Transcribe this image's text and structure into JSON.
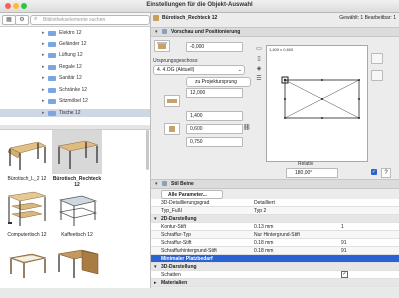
{
  "window": {
    "title": "Einstellungen für die Objekt-Auswahl"
  },
  "library": {
    "search_placeholder": "Bibliothekselemente suchen",
    "tree": [
      {
        "label": "Elektro 12",
        "selected": false
      },
      {
        "label": "Geländer 12",
        "selected": false
      },
      {
        "label": "Lüftung 12",
        "selected": false
      },
      {
        "label": "Regale 12",
        "selected": false
      },
      {
        "label": "Sanitär 12",
        "selected": false
      },
      {
        "label": "Schränke 12",
        "selected": false
      },
      {
        "label": "Sitzmöbel 12",
        "selected": false
      },
      {
        "label": "Tische 12",
        "selected": true
      }
    ],
    "objects": [
      {
        "label": "Bürotisch_L_2 12",
        "selected": false
      },
      {
        "label": "Bürotisch_Rechteck 12",
        "selected": true
      },
      {
        "label": "Computertisch 12",
        "selected": false
      },
      {
        "label": "Kaffeetisch 12",
        "selected": false
      },
      {
        "label": "",
        "selected": false
      },
      {
        "label": "",
        "selected": false
      }
    ]
  },
  "settings": {
    "object_name": "Bürotisch_Rechteck 12",
    "selection_info": "Gewählt: 1 Bearbeitbar: 1",
    "sections": {
      "preview": "Vorschau und Positionierung",
      "style": "Stil Beine",
      "params": "Alle Parameter..."
    },
    "fields": {
      "offset": "-0,000",
      "origin_label": "Ursprungsgeschoss:",
      "origin_value": "4. 4.OG (Aktuell)",
      "projection": "zu Projektursprung",
      "z_value": "12,000",
      "width": "1,400",
      "depth": "0,600",
      "height": "0,750",
      "preview_dims": "1,400 x 0,600",
      "relative": "Relativ",
      "angle": "180,00°"
    },
    "table": [
      {
        "c1": "3D-Detaillierungsgrad",
        "c2": "Detailliert",
        "c3": "",
        "type": "row"
      },
      {
        "c1": "Typ_Fußl",
        "c2": "Typ 2",
        "c3": "",
        "type": "row"
      },
      {
        "c1": "2D-Darstellung",
        "c2": "",
        "c3": "",
        "type": "group"
      },
      {
        "c1": "Kontur-Stift",
        "c2": "0.13 mm",
        "c3": "1",
        "type": "row"
      },
      {
        "c1": "Schraffur-Typ",
        "c2": "Nur Hintergrund-Stift",
        "c3": "",
        "type": "row"
      },
      {
        "c1": "Schraffur-Stift",
        "c2": "0.18 mm",
        "c3": "91",
        "type": "row"
      },
      {
        "c1": "Schraffurhintergrund-Stift",
        "c2": "0.18 mm",
        "c3": "91",
        "type": "row"
      },
      {
        "c1": "Minimaler Platzbedarf",
        "c2": "",
        "c3": "",
        "type": "highlight"
      },
      {
        "c1": "3D-Darstellung",
        "c2": "",
        "c3": "",
        "type": "group"
      },
      {
        "c1": "Schatten",
        "c2": "",
        "c3": "✓",
        "type": "check"
      },
      {
        "c1": "Materialien",
        "c2": "",
        "c3": "",
        "type": "group"
      }
    ]
  }
}
